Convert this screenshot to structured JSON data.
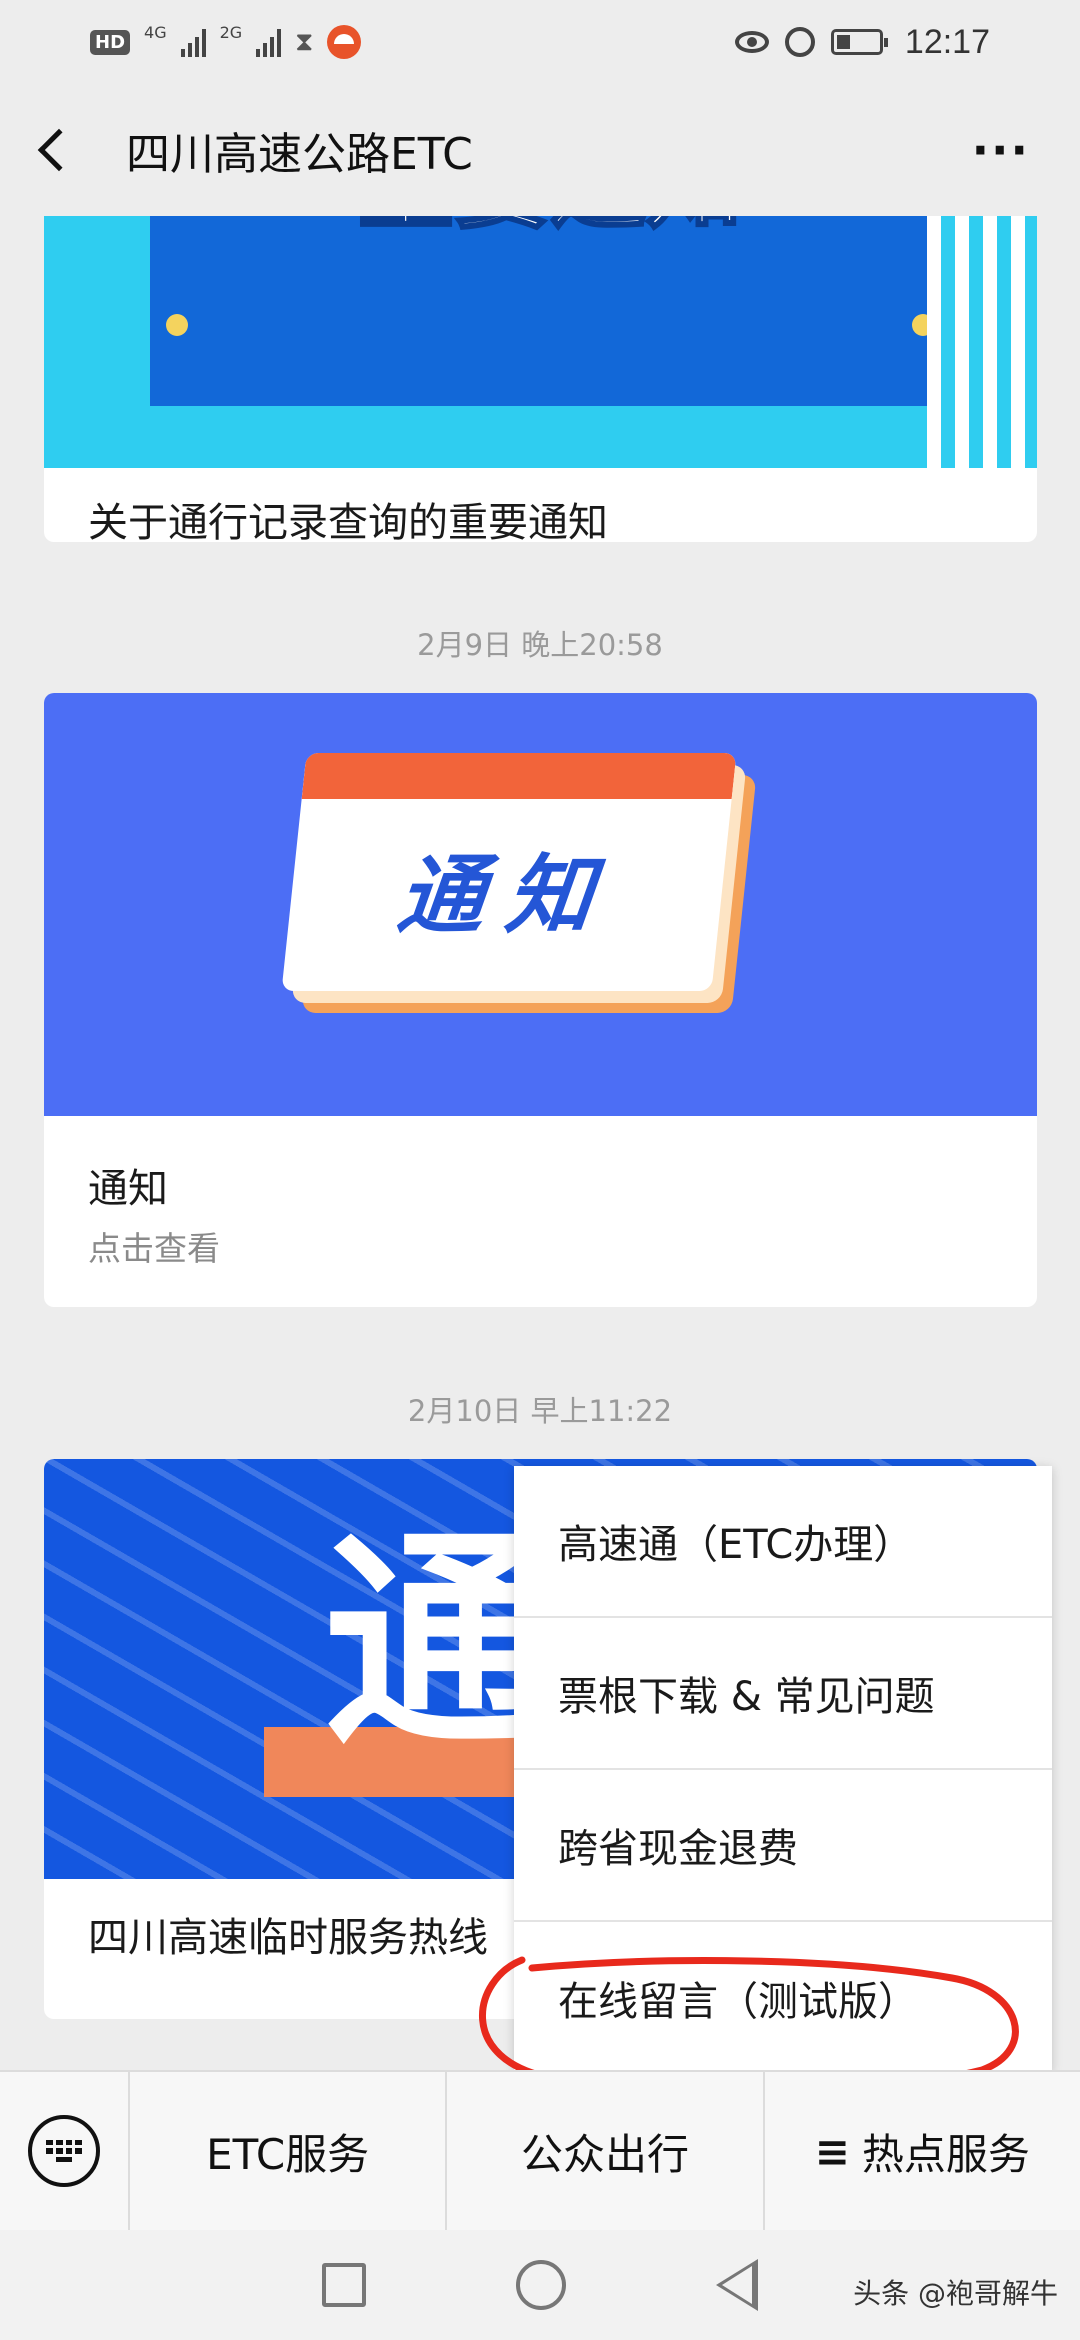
{
  "status_bar": {
    "hd_badge": "HD",
    "network_1": "4G",
    "network_2": "2G",
    "time": "12:17",
    "icons": [
      "signal-icon",
      "hourglass-icon",
      "app-notification-icon",
      "eye-comfort-icon",
      "alarm-icon",
      "battery-icon"
    ]
  },
  "nav": {
    "title": "四川高速公路ETC",
    "more": "···"
  },
  "feed": [
    {
      "cover_heading": "重要通知",
      "title": "关于通行记录查询的重要通知"
    },
    {
      "timestamp": "2月9日 晚上20:58",
      "cover_text": "通知",
      "title": "通知",
      "subtitle": "点击查看"
    },
    {
      "timestamp": "2月10日 早上11:22",
      "cover_text": "通",
      "title": "四川高速临时服务热线"
    }
  ],
  "popup_menu": {
    "items": [
      "高速通（ETC办理）",
      "票根下载 & 常见问题",
      "跨省现金退费",
      "在线留言（测试版）"
    ],
    "highlight_color": "#e8291c"
  },
  "bottom_menu": {
    "items": [
      "ETC服务",
      "公众出行",
      "热点服务"
    ],
    "last_prefix": "≡"
  },
  "watermark": "头条 @袍哥解牛"
}
